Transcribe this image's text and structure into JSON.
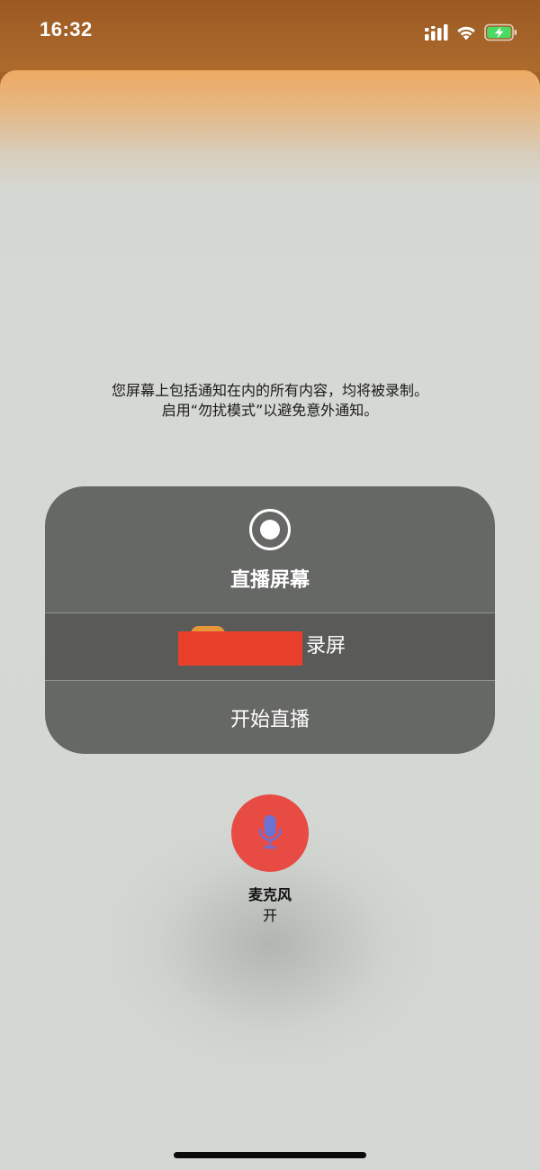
{
  "status_bar": {
    "time": "16:32",
    "icons": [
      "cellular-signal-icon",
      "wifi-icon",
      "battery-charging-icon"
    ],
    "battery_color": "#4cd964"
  },
  "notice": {
    "line1": "您屏幕上包括通知在内的所有内容，均将被录制。",
    "line2": "启用“勿扰模式”以避免意外通知。"
  },
  "broadcast_menu": {
    "icon": "record-icon",
    "title": "直播屏幕",
    "options": [
      {
        "label": "录屏",
        "redacted": true,
        "icon": "app-icon"
      },
      {
        "label": "开始直播"
      }
    ]
  },
  "microphone": {
    "icon": "microphone-icon",
    "label": "麦克风",
    "state": "开",
    "color": "#e84b44"
  },
  "colors": {
    "sheet_top": "#eeaa64",
    "sheet_background": "#d5d8d3",
    "menu_background": "#666865",
    "redaction": "#e8402a"
  }
}
